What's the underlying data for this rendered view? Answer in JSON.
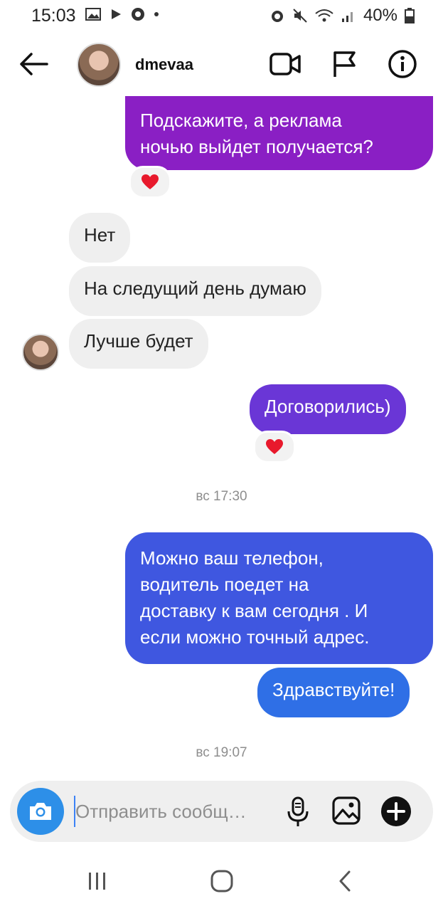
{
  "status_bar": {
    "time": "15:03",
    "battery": "40%",
    "icons": [
      "image-icon",
      "play-icon",
      "shield-icon",
      "dot-icon",
      "alarm-icon",
      "mute-icon",
      "wifi-icon",
      "signal-icon",
      "battery-icon"
    ]
  },
  "header": {
    "username": "dmevaa",
    "icons": [
      "back-arrow-icon",
      "video-call-icon",
      "flag-icon",
      "info-icon"
    ]
  },
  "messages": {
    "m1_line1": "Подскажите, а реклама",
    "m1_line2": "ночью выйдет получается?",
    "m2": "Нет",
    "m3": "На следущий день думаю",
    "m4": "Лучше будет",
    "m5": "Договорились)",
    "time1": "вс 17:30",
    "m6_line1": "Можно ваш телефон,",
    "m6_line2": "водитель поедет на",
    "m6_line3": "доставку к вам сегодня . И",
    "m6_line4": "если можно точный адрес.",
    "m7": "Здравствуйте!",
    "time2": "вс 19:07"
  },
  "composer": {
    "placeholder": "Отправить сообщ…",
    "value": ""
  },
  "colors": {
    "purple": "#8a1fc4",
    "violet": "#6a36d6",
    "indigo": "#3f57e0",
    "blue": "#2f6fe6",
    "heart": "#e8192c",
    "camera": "#2d8fe8"
  }
}
